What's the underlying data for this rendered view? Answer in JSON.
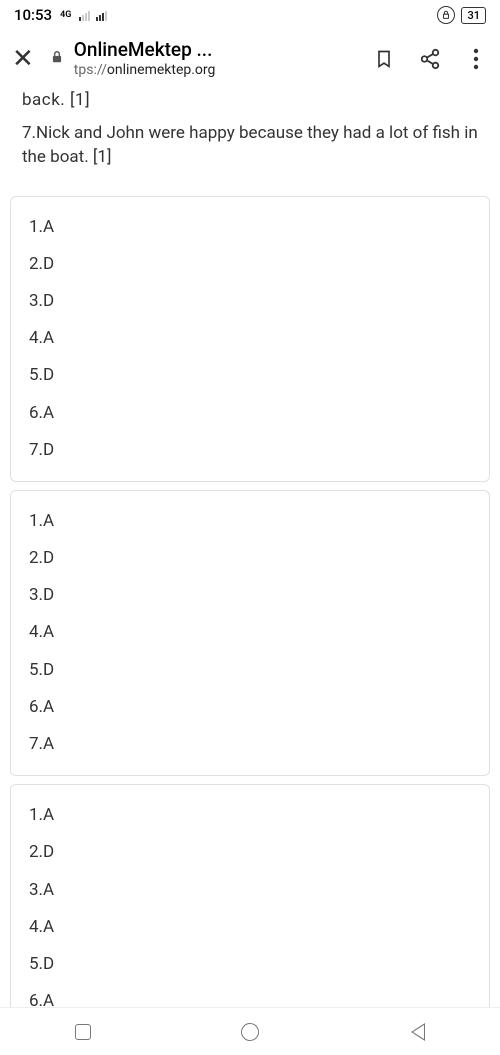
{
  "status": {
    "time": "10:53",
    "network_4g": "4G",
    "battery": "31"
  },
  "browser": {
    "title": "OnlineMektep ...",
    "url_prefix": "tps://",
    "url_domain": "onlinemektep.org"
  },
  "content": {
    "cut_line": "back. [1]",
    "question": "7.Nick and John were happy because they had a lot of fish in the boat. [1]"
  },
  "cards": [
    {
      "items": [
        "1.A",
        "2.D",
        "3.D",
        "4.A",
        "5.D",
        "6.A",
        "7.D"
      ]
    },
    {
      "items": [
        "1.A",
        "2.D",
        "3.D",
        "4.A",
        "5.D",
        "6.A",
        "7.A"
      ]
    },
    {
      "items": [
        "1.A",
        "2.D",
        "3.A",
        "4.A",
        "5.D",
        "6.A"
      ]
    }
  ]
}
